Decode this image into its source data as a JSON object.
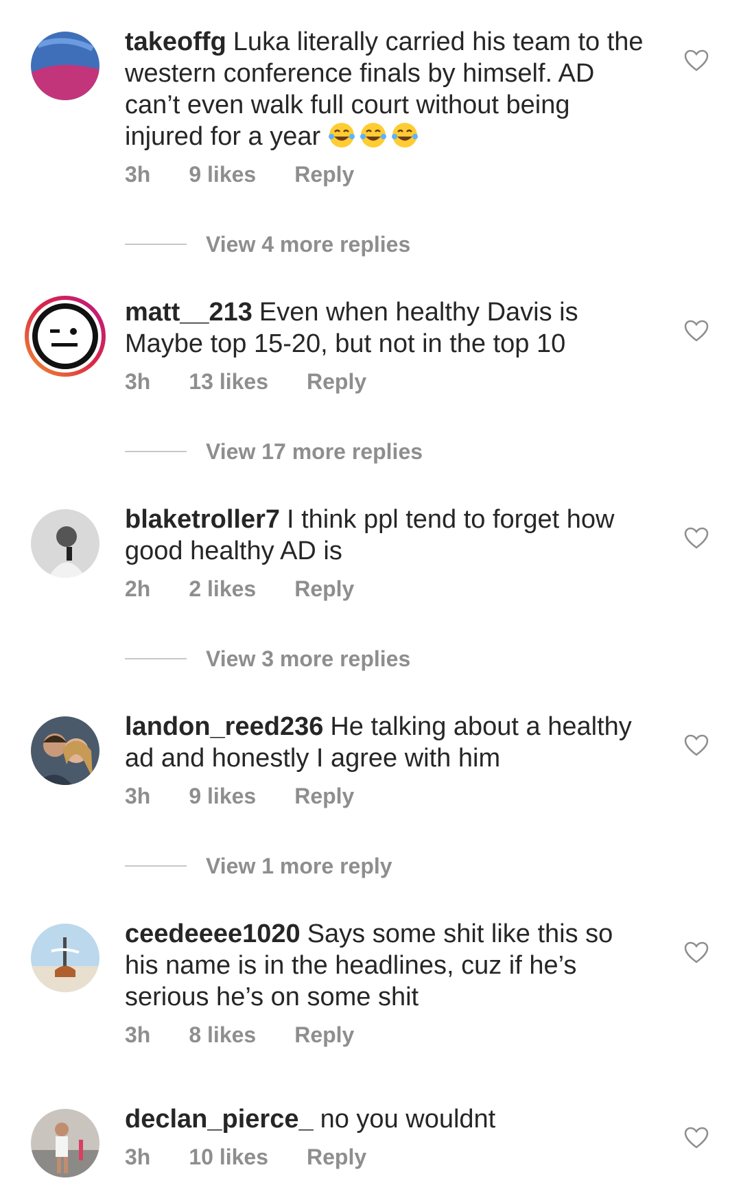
{
  "comments": [
    {
      "username": "takeoffg",
      "text": "Luka literally carried his team to the western conference finals by himself. AD can’t even walk full court without being injured for a year",
      "emoji": "😂😂😂",
      "time": "3h",
      "likes": "9 likes",
      "reply": "Reply",
      "view_more": "View 4 more replies"
    },
    {
      "username": "matt__213",
      "text": "Even when healthy Davis is Maybe top 15-20, but not in the top 10",
      "time": "3h",
      "likes": "13 likes",
      "reply": "Reply",
      "view_more": "View 17 more replies"
    },
    {
      "username": "blaketroller7",
      "text": "I think ppl tend to forget how good healthy AD is",
      "time": "2h",
      "likes": "2 likes",
      "reply": "Reply",
      "view_more": "View 3 more replies"
    },
    {
      "username": "landon_reed236",
      "text": "He talking about a healthy ad and honestly I agree with him",
      "time": "3h",
      "likes": "9 likes",
      "reply": "Reply",
      "view_more": "View 1 more reply"
    },
    {
      "username": "ceedeeee1020",
      "text": "Says some shit like this so his name is in the headlines, cuz if he’s serious he’s on some shit",
      "time": "3h",
      "likes": "8 likes",
      "reply": "Reply"
    },
    {
      "username": "declan_pierce_",
      "text": "no you wouldnt",
      "time": "3h",
      "likes": "10 likes",
      "reply": "Reply"
    }
  ],
  "icons": {
    "heart": "heart-outline-icon",
    "emoji": "tears-of-joy-emoji"
  },
  "colors": {
    "text": "#262626",
    "meta": "#8e8e8e",
    "line": "#c7c7c7",
    "story_ring_start": "#f09433",
    "story_ring_end": "#bc1888"
  }
}
